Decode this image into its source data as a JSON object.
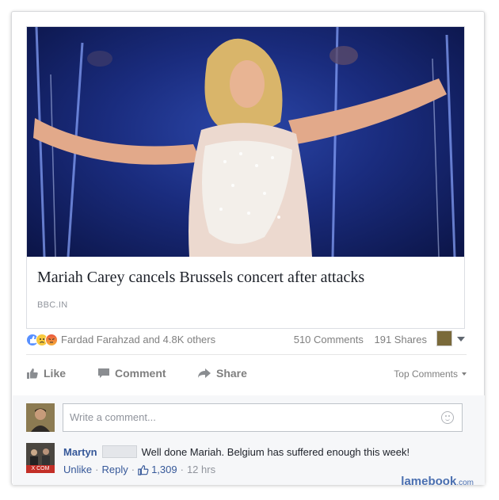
{
  "post": {
    "headline": "Mariah Carey cancels Brussels concert after attacks",
    "domain": "BBC.IN"
  },
  "reactions": {
    "names": "Fardad Farahzad and 4.8K others",
    "comments_count": "510 Comments",
    "shares_count": "191 Shares"
  },
  "actions": {
    "like": "Like",
    "comment": "Comment",
    "share": "Share",
    "top_comments": "Top Comments"
  },
  "composer": {
    "placeholder": "Write a comment..."
  },
  "comment": {
    "author": "Martyn",
    "text": "Well done Mariah. Belgium has suffered enough this week!",
    "unlike": "Unlike",
    "reply": "Reply",
    "likes": "1,309",
    "time": "12 hrs",
    "avatar_tag": "X COM"
  },
  "watermark": {
    "main": "lamebook",
    "suffix": ".com"
  },
  "colors": {
    "link_blue": "#365899",
    "like_blue": "#5890ff",
    "stage_blue": "#1a2c7e"
  }
}
